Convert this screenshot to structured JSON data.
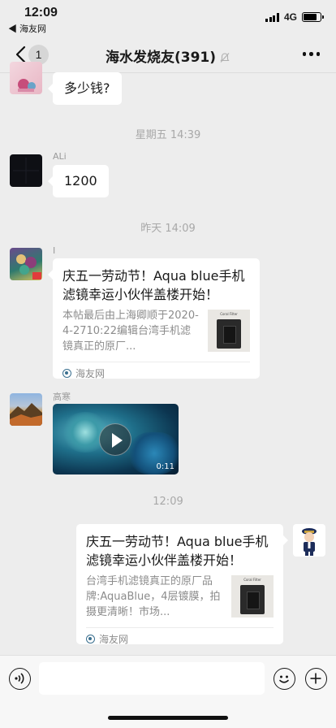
{
  "status_bar": {
    "time": "12:09",
    "back_app": "◀ 海友网",
    "network": "4G",
    "battery_level": 0.8
  },
  "nav": {
    "back_count": "1",
    "title": "海水发烧友(391)"
  },
  "messages": [
    {
      "type": "text",
      "direction": "in",
      "text": "多少钱?"
    },
    {
      "type": "time",
      "text": "星期五 14:39"
    },
    {
      "type": "text",
      "direction": "in",
      "sender": "ALi",
      "text": "1200"
    },
    {
      "type": "time",
      "text": "昨天 14:09"
    },
    {
      "type": "link",
      "direction": "in",
      "sender": "I",
      "title": "庆五一劳动节！Aqua blue手机滤镜幸运小伙伴盖楼开始！",
      "desc": "本帖最后由上海卿顺于2020-4-2710:22编辑台湾手机滤镜真正的原厂...",
      "thumb_label": "Coral Filter",
      "source": "海友网"
    },
    {
      "type": "video",
      "direction": "in",
      "sender": "高寒",
      "duration": "0:11"
    },
    {
      "type": "time",
      "text": "12:09"
    },
    {
      "type": "link",
      "direction": "out",
      "title": "庆五一劳动节！Aqua blue手机滤镜幸运小伙伴盖楼开始！",
      "desc": "台湾手机滤镜真正的原厂品牌:AquaBlue，4层镀膜，拍摄更清晰！市场...",
      "thumb_label": "Coral Filter",
      "source": "海友网"
    }
  ],
  "icons": [
    "back-icon",
    "mute-icon",
    "more-icon",
    "play-icon",
    "voice-icon",
    "emoji-icon",
    "plus-icon",
    "haiyou-source-icon"
  ]
}
